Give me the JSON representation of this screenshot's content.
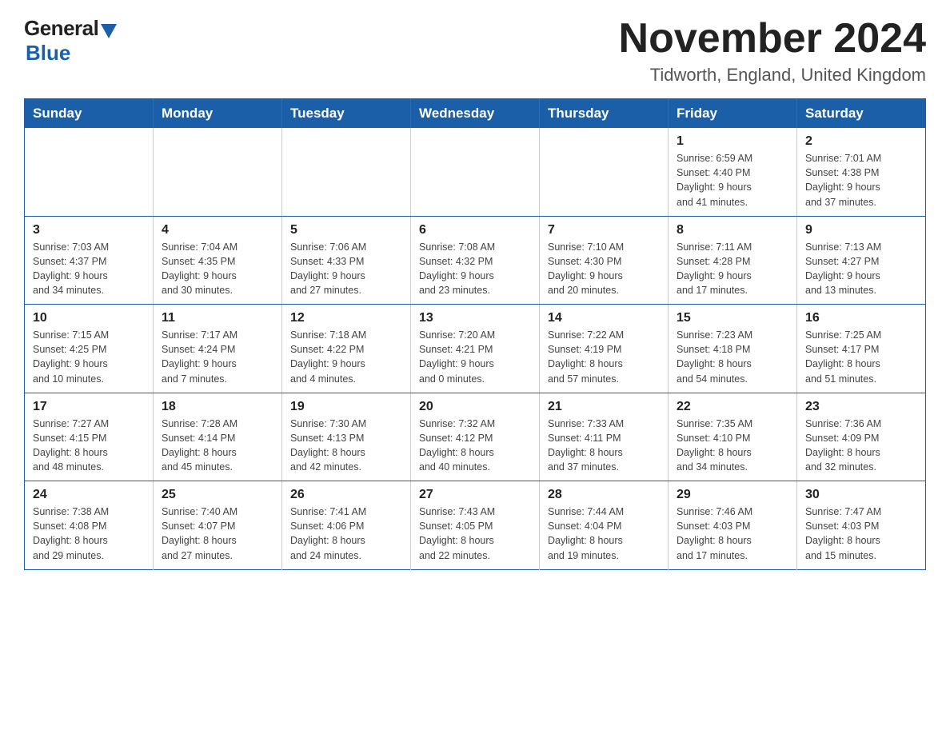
{
  "logo": {
    "general": "General",
    "blue": "Blue"
  },
  "title": "November 2024",
  "subtitle": "Tidworth, England, United Kingdom",
  "days_of_week": [
    "Sunday",
    "Monday",
    "Tuesday",
    "Wednesday",
    "Thursday",
    "Friday",
    "Saturday"
  ],
  "weeks": [
    [
      {
        "day": "",
        "info": ""
      },
      {
        "day": "",
        "info": ""
      },
      {
        "day": "",
        "info": ""
      },
      {
        "day": "",
        "info": ""
      },
      {
        "day": "",
        "info": ""
      },
      {
        "day": "1",
        "info": "Sunrise: 6:59 AM\nSunset: 4:40 PM\nDaylight: 9 hours\nand 41 minutes."
      },
      {
        "day": "2",
        "info": "Sunrise: 7:01 AM\nSunset: 4:38 PM\nDaylight: 9 hours\nand 37 minutes."
      }
    ],
    [
      {
        "day": "3",
        "info": "Sunrise: 7:03 AM\nSunset: 4:37 PM\nDaylight: 9 hours\nand 34 minutes."
      },
      {
        "day": "4",
        "info": "Sunrise: 7:04 AM\nSunset: 4:35 PM\nDaylight: 9 hours\nand 30 minutes."
      },
      {
        "day": "5",
        "info": "Sunrise: 7:06 AM\nSunset: 4:33 PM\nDaylight: 9 hours\nand 27 minutes."
      },
      {
        "day": "6",
        "info": "Sunrise: 7:08 AM\nSunset: 4:32 PM\nDaylight: 9 hours\nand 23 minutes."
      },
      {
        "day": "7",
        "info": "Sunrise: 7:10 AM\nSunset: 4:30 PM\nDaylight: 9 hours\nand 20 minutes."
      },
      {
        "day": "8",
        "info": "Sunrise: 7:11 AM\nSunset: 4:28 PM\nDaylight: 9 hours\nand 17 minutes."
      },
      {
        "day": "9",
        "info": "Sunrise: 7:13 AM\nSunset: 4:27 PM\nDaylight: 9 hours\nand 13 minutes."
      }
    ],
    [
      {
        "day": "10",
        "info": "Sunrise: 7:15 AM\nSunset: 4:25 PM\nDaylight: 9 hours\nand 10 minutes."
      },
      {
        "day": "11",
        "info": "Sunrise: 7:17 AM\nSunset: 4:24 PM\nDaylight: 9 hours\nand 7 minutes."
      },
      {
        "day": "12",
        "info": "Sunrise: 7:18 AM\nSunset: 4:22 PM\nDaylight: 9 hours\nand 4 minutes."
      },
      {
        "day": "13",
        "info": "Sunrise: 7:20 AM\nSunset: 4:21 PM\nDaylight: 9 hours\nand 0 minutes."
      },
      {
        "day": "14",
        "info": "Sunrise: 7:22 AM\nSunset: 4:19 PM\nDaylight: 8 hours\nand 57 minutes."
      },
      {
        "day": "15",
        "info": "Sunrise: 7:23 AM\nSunset: 4:18 PM\nDaylight: 8 hours\nand 54 minutes."
      },
      {
        "day": "16",
        "info": "Sunrise: 7:25 AM\nSunset: 4:17 PM\nDaylight: 8 hours\nand 51 minutes."
      }
    ],
    [
      {
        "day": "17",
        "info": "Sunrise: 7:27 AM\nSunset: 4:15 PM\nDaylight: 8 hours\nand 48 minutes."
      },
      {
        "day": "18",
        "info": "Sunrise: 7:28 AM\nSunset: 4:14 PM\nDaylight: 8 hours\nand 45 minutes."
      },
      {
        "day": "19",
        "info": "Sunrise: 7:30 AM\nSunset: 4:13 PM\nDaylight: 8 hours\nand 42 minutes."
      },
      {
        "day": "20",
        "info": "Sunrise: 7:32 AM\nSunset: 4:12 PM\nDaylight: 8 hours\nand 40 minutes."
      },
      {
        "day": "21",
        "info": "Sunrise: 7:33 AM\nSunset: 4:11 PM\nDaylight: 8 hours\nand 37 minutes."
      },
      {
        "day": "22",
        "info": "Sunrise: 7:35 AM\nSunset: 4:10 PM\nDaylight: 8 hours\nand 34 minutes."
      },
      {
        "day": "23",
        "info": "Sunrise: 7:36 AM\nSunset: 4:09 PM\nDaylight: 8 hours\nand 32 minutes."
      }
    ],
    [
      {
        "day": "24",
        "info": "Sunrise: 7:38 AM\nSunset: 4:08 PM\nDaylight: 8 hours\nand 29 minutes."
      },
      {
        "day": "25",
        "info": "Sunrise: 7:40 AM\nSunset: 4:07 PM\nDaylight: 8 hours\nand 27 minutes."
      },
      {
        "day": "26",
        "info": "Sunrise: 7:41 AM\nSunset: 4:06 PM\nDaylight: 8 hours\nand 24 minutes."
      },
      {
        "day": "27",
        "info": "Sunrise: 7:43 AM\nSunset: 4:05 PM\nDaylight: 8 hours\nand 22 minutes."
      },
      {
        "day": "28",
        "info": "Sunrise: 7:44 AM\nSunset: 4:04 PM\nDaylight: 8 hours\nand 19 minutes."
      },
      {
        "day": "29",
        "info": "Sunrise: 7:46 AM\nSunset: 4:03 PM\nDaylight: 8 hours\nand 17 minutes."
      },
      {
        "day": "30",
        "info": "Sunrise: 7:47 AM\nSunset: 4:03 PM\nDaylight: 8 hours\nand 15 minutes."
      }
    ]
  ]
}
